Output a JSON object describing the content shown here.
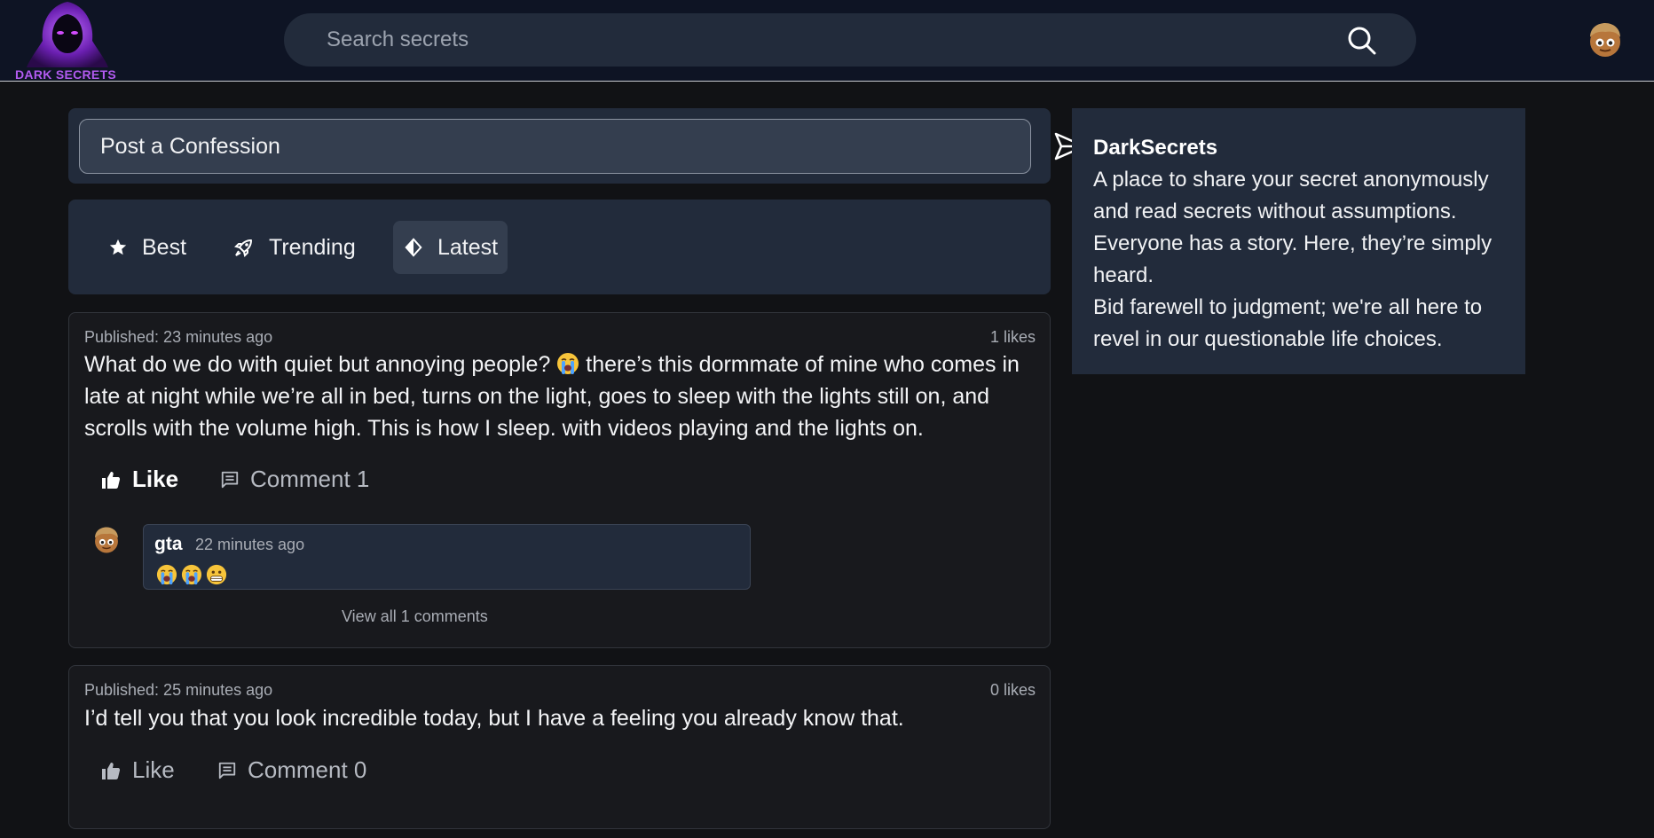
{
  "app": {
    "logo_text": "DARK SECRETS"
  },
  "search": {
    "placeholder": "Search secrets",
    "icon": "search-icon"
  },
  "composer": {
    "placeholder": "Post a Confession",
    "send_icon": "send-icon"
  },
  "tabs": [
    {
      "label": "Best",
      "icon": "star-icon",
      "active": false
    },
    {
      "label": "Trending",
      "icon": "rocket-icon",
      "active": false
    },
    {
      "label": "Latest",
      "icon": "diamond-icon",
      "active": true
    }
  ],
  "posts": [
    {
      "published": "Published: 23 minutes ago",
      "likes": "1 likes",
      "text_before_emoji": "What do we do with quiet but annoying people?",
      "text_after_emoji": "there’s this dormmate of mine who comes in late at night while we’re all in bed, turns on the light, goes to sleep with the lights still on, and scrolls with the volume high. This is how I sleep. with videos playing and the lights on.",
      "inline_emoji": "loudly-crying-face-emoji",
      "like_label": "Like",
      "liked": true,
      "comment_label": "Comment 1",
      "comments": [
        {
          "user": "gta",
          "time": "22 minutes ago",
          "emojis": [
            "loudly-crying-face-emoji",
            "loudly-crying-face-emoji",
            "grimacing-face-emoji"
          ]
        }
      ],
      "view_all": "View all 1 comments"
    },
    {
      "published": "Published: 25 minutes ago",
      "likes": "0 likes",
      "text": "I’d tell you that you look incredible today, but I have a feeling you already know that.",
      "like_label": "Like",
      "liked": false,
      "comment_label": "Comment 0"
    }
  ],
  "about": {
    "title": "DarkSecrets",
    "lines": [
      "A place to share your secret anonymously",
      "and read secrets without assumptions.",
      "Everyone has a story. Here, they’re simply",
      "heard.",
      "Bid farewell to judgment; we're all here to",
      "revel in our questionable life choices."
    ]
  },
  "colors": {
    "header_bg": "#0e1424",
    "panel_bg": "#222b3b",
    "page_bg": "#111215",
    "card_bg": "#18191d",
    "brand_purple": "#b25bf0"
  }
}
